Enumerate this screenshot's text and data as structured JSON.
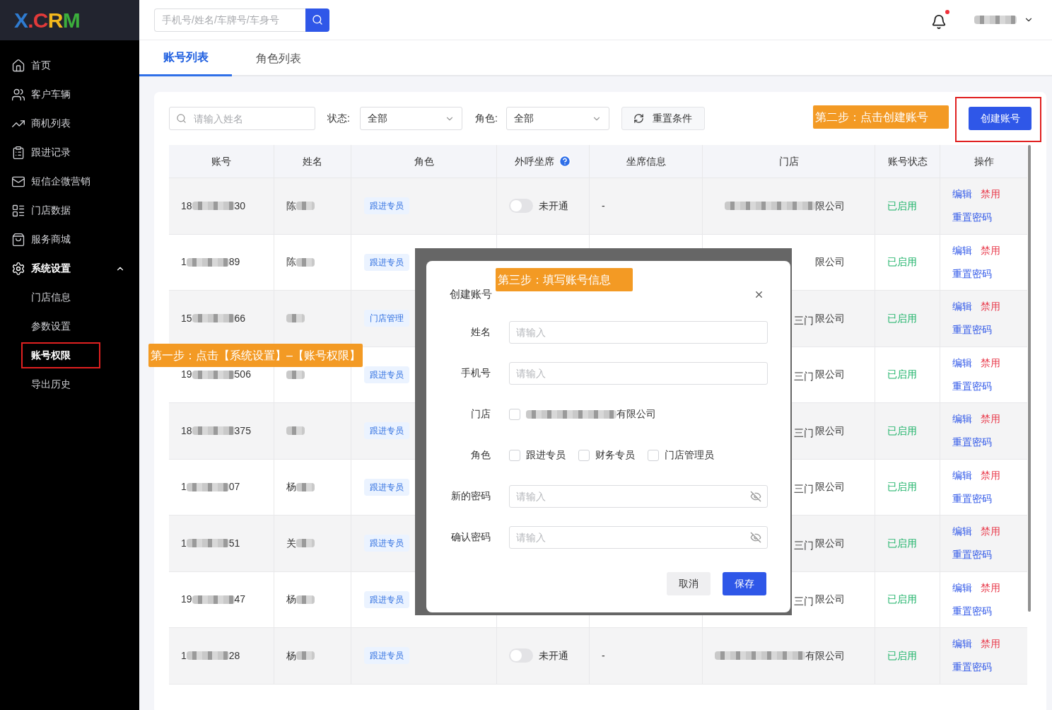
{
  "logo": {
    "letters": [
      {
        "text": "X",
        "color": "#2f7bd0"
      },
      {
        "text": ".",
        "color": "#e23a3a"
      },
      {
        "text": "C",
        "color": "#e23a3a"
      },
      {
        "text": "R",
        "color": "#f3b71c"
      },
      {
        "text": "M",
        "color": "#3caf3c"
      }
    ]
  },
  "header": {
    "search": {
      "placeholder": "手机号/姓名/车牌号/车身号"
    },
    "notification": {
      "unread": true
    }
  },
  "sidebar": {
    "items": [
      {
        "label": "首页",
        "selected": false
      },
      {
        "label": "客户车辆",
        "selected": false
      },
      {
        "label": "商机列表",
        "selected": false
      },
      {
        "label": "跟进记录",
        "selected": false
      },
      {
        "label": "短信企微营销",
        "selected": false
      },
      {
        "label": "门店数据",
        "selected": false
      },
      {
        "label": "服务商城",
        "selected": false
      },
      {
        "label": "系统设置",
        "selected": false,
        "expanded": true,
        "children": [
          {
            "label": "门店信息",
            "selected": false
          },
          {
            "label": "参数设置",
            "selected": false
          },
          {
            "label": "账号权限",
            "selected": true
          },
          {
            "label": "导出历史",
            "selected": false
          }
        ]
      }
    ]
  },
  "tabs": [
    {
      "label": "账号列表",
      "selected": true
    },
    {
      "label": "角色列表",
      "selected": false
    }
  ],
  "filters": {
    "name_search": {
      "placeholder": "请输入姓名"
    },
    "status": {
      "label": "状态:",
      "value": "全部"
    },
    "role": {
      "label": "角色:",
      "value": "全部"
    },
    "reset_button": "重置条件",
    "create_button": "创建账号"
  },
  "table": {
    "columns": [
      {
        "label": "账号"
      },
      {
        "label": "姓名"
      },
      {
        "label": "角色"
      },
      {
        "label": "外呼坐席",
        "help": true
      },
      {
        "label": "坐席信息"
      },
      {
        "label": "门店"
      },
      {
        "label": "账号状态"
      },
      {
        "label": "操作"
      }
    ],
    "rows": [
      {
        "account_start": "18",
        "account_end": "30",
        "name_start": "陈",
        "role": "跟进专员",
        "seat": {
          "on": false,
          "label": "未开通"
        },
        "seat_info": "-",
        "store_end": "限公司",
        "status": "已启用",
        "actions": [
          "编辑",
          "禁用",
          "重置密码"
        ]
      },
      {
        "account_start": "1",
        "account_end": "89",
        "name_start": "陈",
        "role": "跟进专员",
        "store_end": "限公司",
        "status": "已启用",
        "actions": [
          "编辑",
          "禁用",
          "重置密码"
        ]
      },
      {
        "account_start": "15",
        "account_end": "66",
        "role": "门店管理",
        "store_prefix": "三门",
        "store_end": "限公司",
        "status": "已启用",
        "actions": [
          "编辑",
          "禁用",
          "重置密码"
        ]
      },
      {
        "account_start": "19",
        "account_end": "506",
        "role": "跟进专员",
        "store_prefix": "三门",
        "store_end": "限公司",
        "status": "已启用",
        "actions": [
          "编辑",
          "禁用",
          "重置密码"
        ]
      },
      {
        "account_start": "18",
        "account_end": "375",
        "role": "跟进专员",
        "store_prefix": "三门",
        "store_end": "限公司",
        "status": "已启用",
        "actions": [
          "编辑",
          "禁用",
          "重置密码"
        ]
      },
      {
        "account_start": "1",
        "account_end": "07",
        "name_start": "杨",
        "role": "跟进专员",
        "store_prefix": "三门",
        "store_end": "限公司",
        "status": "已启用",
        "actions": [
          "编辑",
          "禁用",
          "重置密码"
        ]
      },
      {
        "account_start": "1",
        "account_end": "51",
        "name_start": "关",
        "role": "跟进专员",
        "store_prefix": "三门",
        "store_end": "限公司",
        "status": "已启用",
        "actions": [
          "编辑",
          "禁用",
          "重置密码"
        ]
      },
      {
        "account_start": "19",
        "account_end": "47",
        "name_start": "杨",
        "role": "跟进专员",
        "store_prefix": "三门",
        "store_end": "限公司",
        "status": "已启用",
        "actions": [
          "编辑",
          "禁用",
          "重置密码"
        ]
      },
      {
        "account_start": "1",
        "account_end": "28",
        "name_start": "杨",
        "role": "跟进专员",
        "seat": {
          "on": false,
          "label": "未开通"
        },
        "seat_info": "-",
        "store_end": "有限公司",
        "status": "已启用",
        "actions": [
          "编辑",
          "禁用",
          "重置密码"
        ]
      }
    ]
  },
  "dialog": {
    "title": "创建账号",
    "fields": [
      {
        "kind": "text",
        "label": "姓名",
        "placeholder": "请输入"
      },
      {
        "kind": "text",
        "label": "手机号",
        "placeholder": "请输入"
      },
      {
        "kind": "store",
        "label": "门店",
        "options": [
          {
            "label_end": "有限公司",
            "checked": false
          }
        ]
      },
      {
        "kind": "checkboxes",
        "label": "角色",
        "options": [
          {
            "label": "跟进专员",
            "checked": false
          },
          {
            "label": "财务专员",
            "checked": false
          },
          {
            "label": "门店管理员",
            "checked": false
          }
        ]
      },
      {
        "kind": "password",
        "label": "新的密码",
        "placeholder": "请输入"
      },
      {
        "kind": "password",
        "label": "确认密码",
        "placeholder": "请输入"
      }
    ],
    "buttons": [
      {
        "label": "取消",
        "primary": false
      },
      {
        "label": "保存",
        "primary": true
      }
    ]
  },
  "annotations": [
    {
      "text": "第一步：点击【系统设置】–【账号权限】"
    },
    {
      "text": "第二步：点击创建账号"
    },
    {
      "text": "第三步：填写账号信息"
    }
  ]
}
